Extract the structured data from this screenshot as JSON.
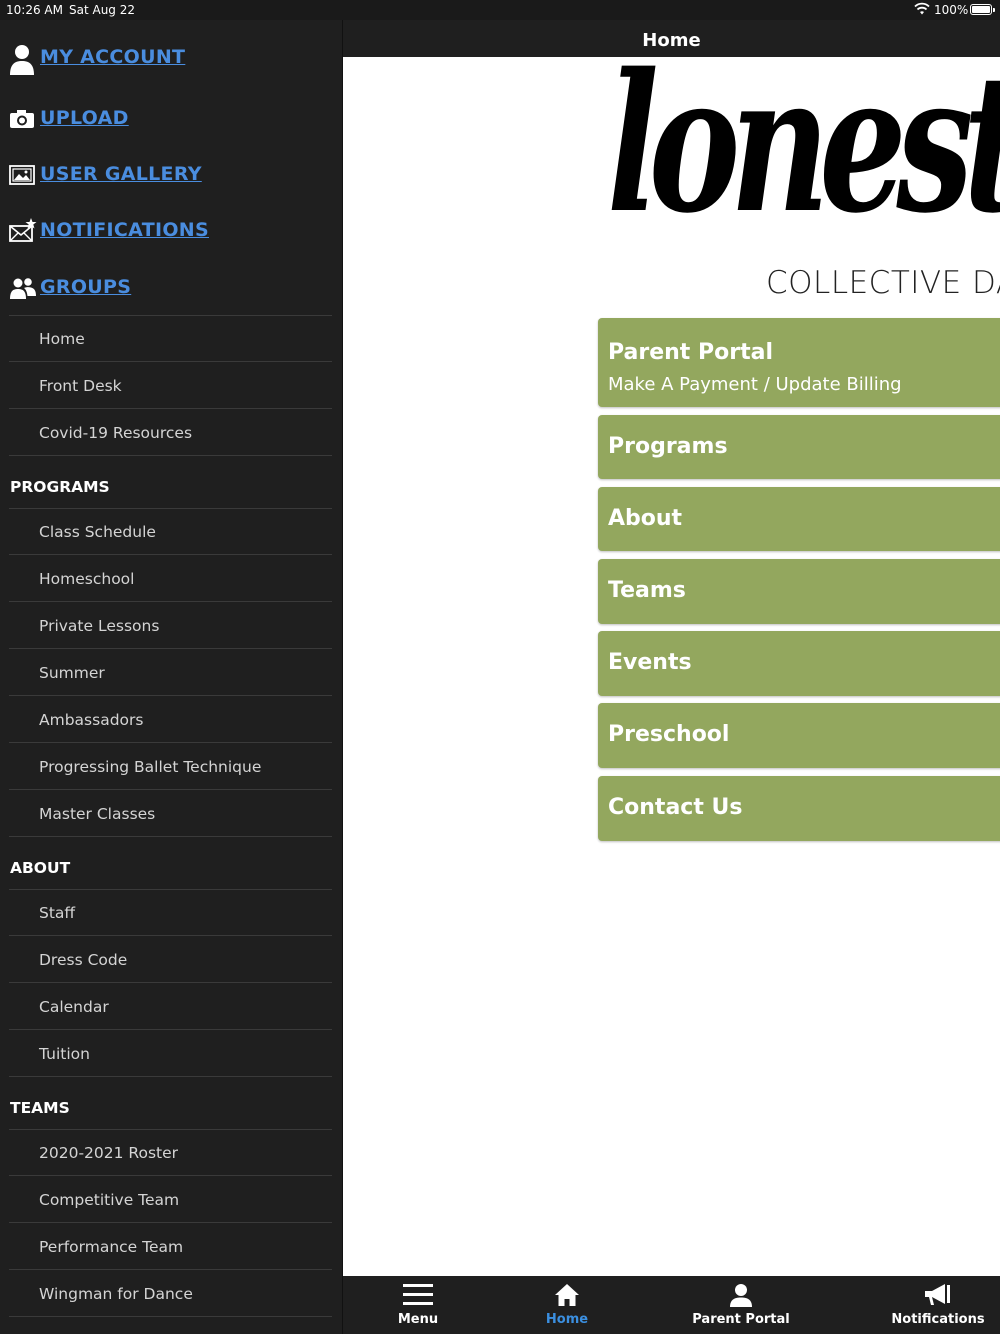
{
  "status_bar": {
    "time": "10:26 AM",
    "date": "Sat Aug 22",
    "battery": "100%"
  },
  "header": {
    "title": "Home"
  },
  "sidebar": {
    "account_items": [
      {
        "label": "MY ACCOUNT",
        "icon": "user-icon"
      },
      {
        "label": "UPLOAD",
        "icon": "camera-icon"
      },
      {
        "label": "USER GALLERY",
        "icon": "gallery-icon"
      },
      {
        "label": "NOTIFICATIONS",
        "icon": "mail-star-icon"
      },
      {
        "label": "GROUPS",
        "icon": "groups-icon"
      }
    ],
    "top_links": [
      "Home",
      "Front Desk",
      "Covid-19 Resources"
    ],
    "sections": [
      {
        "title": "PROGRAMS",
        "items": [
          "Class Schedule",
          "Homeschool",
          "Private Lessons",
          "Summer",
          "Ambassadors",
          "Progressing Ballet Technique",
          "Master Classes"
        ]
      },
      {
        "title": "ABOUT",
        "items": [
          "Staff",
          "Dress Code",
          "Calendar",
          "Tuition"
        ]
      },
      {
        "title": "TEAMS",
        "items": [
          "2020-2021 Roster",
          "Competitive Team",
          "Performance Team",
          "Wingman for Dance"
        ]
      }
    ]
  },
  "main": {
    "logo_script": "lonesta",
    "logo_subtitle": "COLLECTIVE DA",
    "accent_color": "#93a75e",
    "buttons": [
      {
        "title": "Parent Portal",
        "subtitle": "Make A Payment / Update Billing"
      },
      {
        "title": "Programs"
      },
      {
        "title": "About"
      },
      {
        "title": "Teams"
      },
      {
        "title": "Events"
      },
      {
        "title": "Preschool"
      },
      {
        "title": "Contact Us"
      }
    ]
  },
  "tabbar": {
    "tabs": [
      {
        "label": "Menu",
        "icon": "menu-icon"
      },
      {
        "label": "Home",
        "icon": "home-icon",
        "active": true
      },
      {
        "label": "Parent Portal",
        "icon": "person-icon"
      },
      {
        "label": "Notifications",
        "icon": "megaphone-icon"
      }
    ],
    "active_color": "#3b8fe0"
  }
}
